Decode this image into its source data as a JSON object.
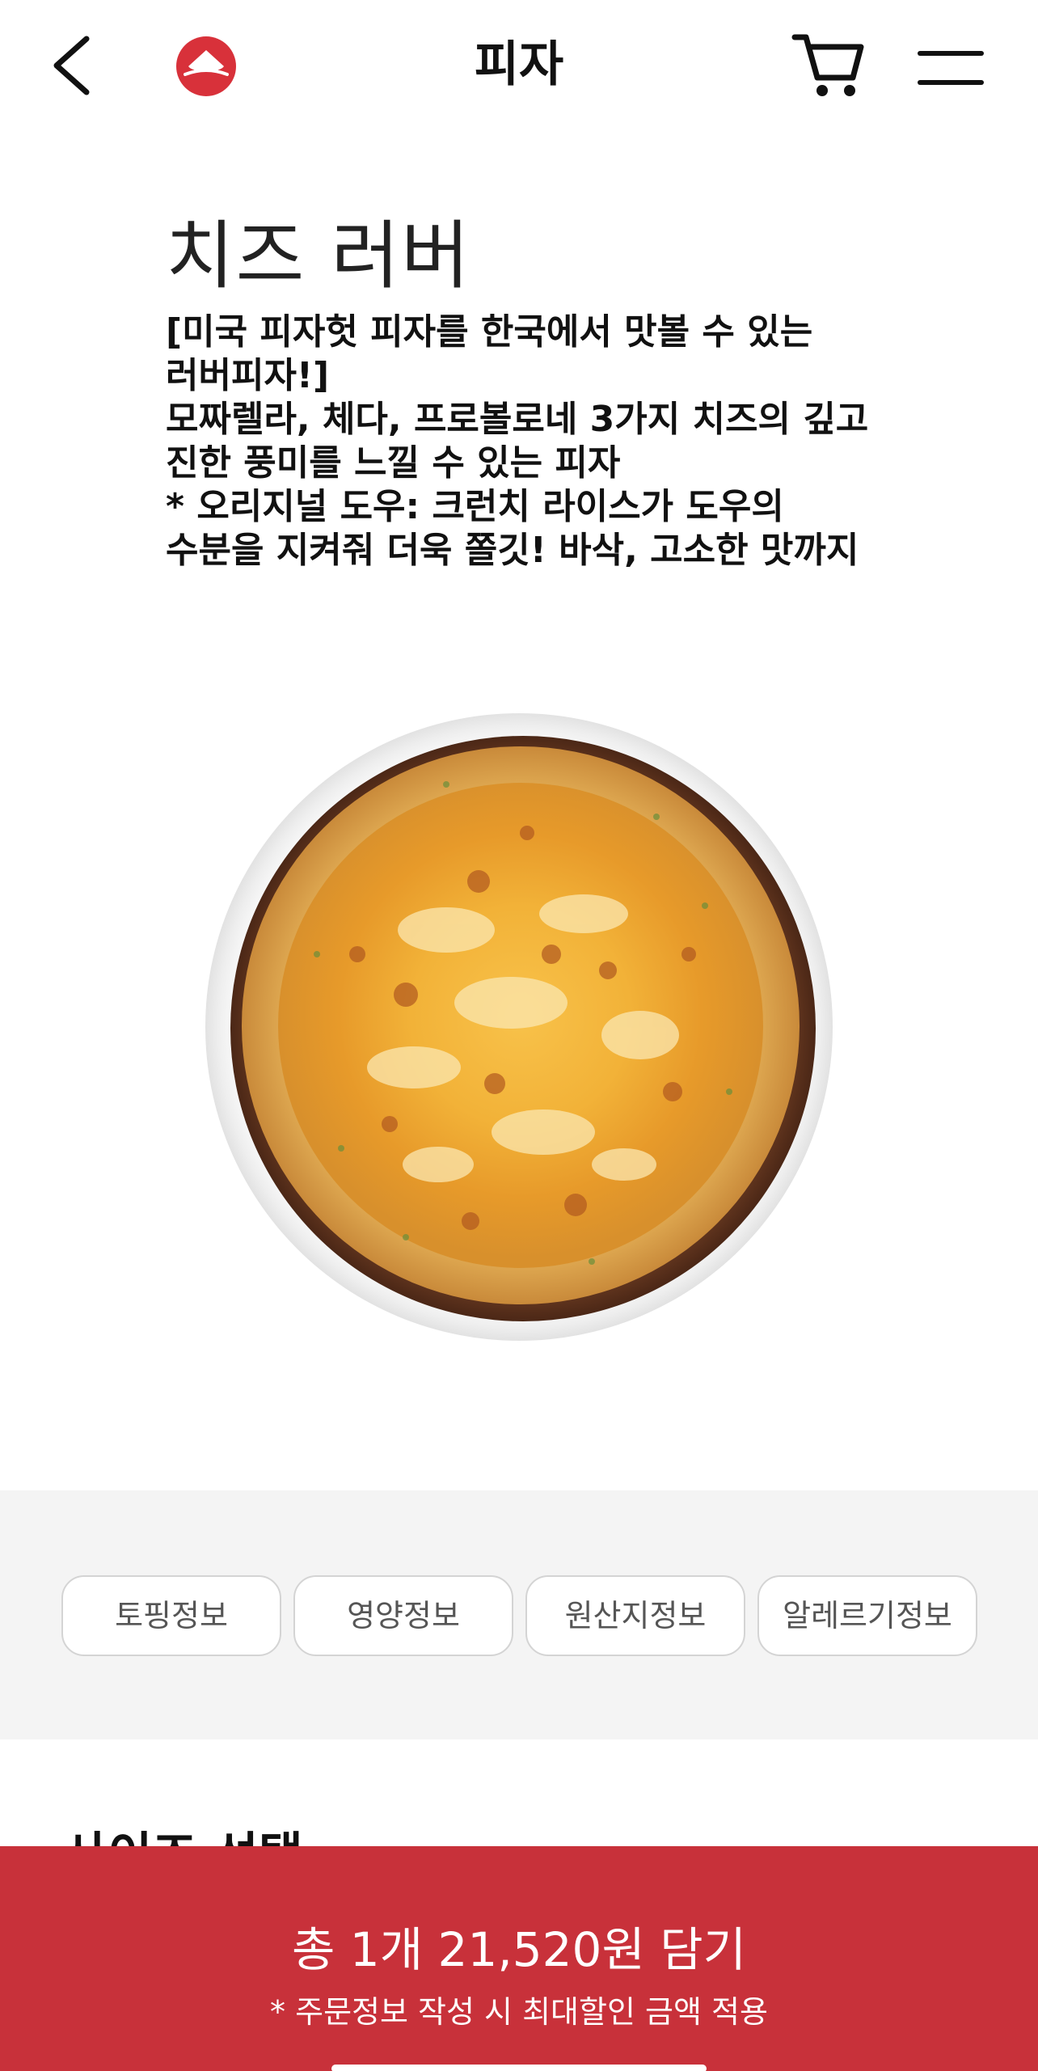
{
  "header": {
    "title": "피자",
    "back_icon": "chevron-left-icon",
    "logo": "pizza-hut-logo",
    "cart_icon": "cart-icon",
    "menu_icon": "hamburger-menu-icon"
  },
  "product": {
    "name": "치즈 러버",
    "description_lines": [
      "[미국 피자헛 피자를 한국에서 맛볼 수 있는",
      "러버피자!]",
      "모짜렐라, 체다, 프로볼로네 3가지 치즈의 깊고",
      "진한 풍미를 느낄 수 있는 피자",
      "* 오리지널 도우: 크런치 라이스가 도우의",
      "수분을 지켜줘 더욱 쫄깃! 바삭, 고소한 맛까지"
    ]
  },
  "info_tabs": [
    {
      "label": "토핑정보"
    },
    {
      "label": "영양정보"
    },
    {
      "label": "원산지정보"
    },
    {
      "label": "알레르기정보"
    }
  ],
  "next_section": {
    "title": "사이즈 선택"
  },
  "cta": {
    "main_label": "총 1개 21,520원 담기",
    "sub_label": "* 주문정보 작성 시 최대할인 금액 적용"
  },
  "colors": {
    "brand_red": "#c8313a",
    "band_gray": "#f4f4f4",
    "button_border": "#d4d4d4"
  }
}
